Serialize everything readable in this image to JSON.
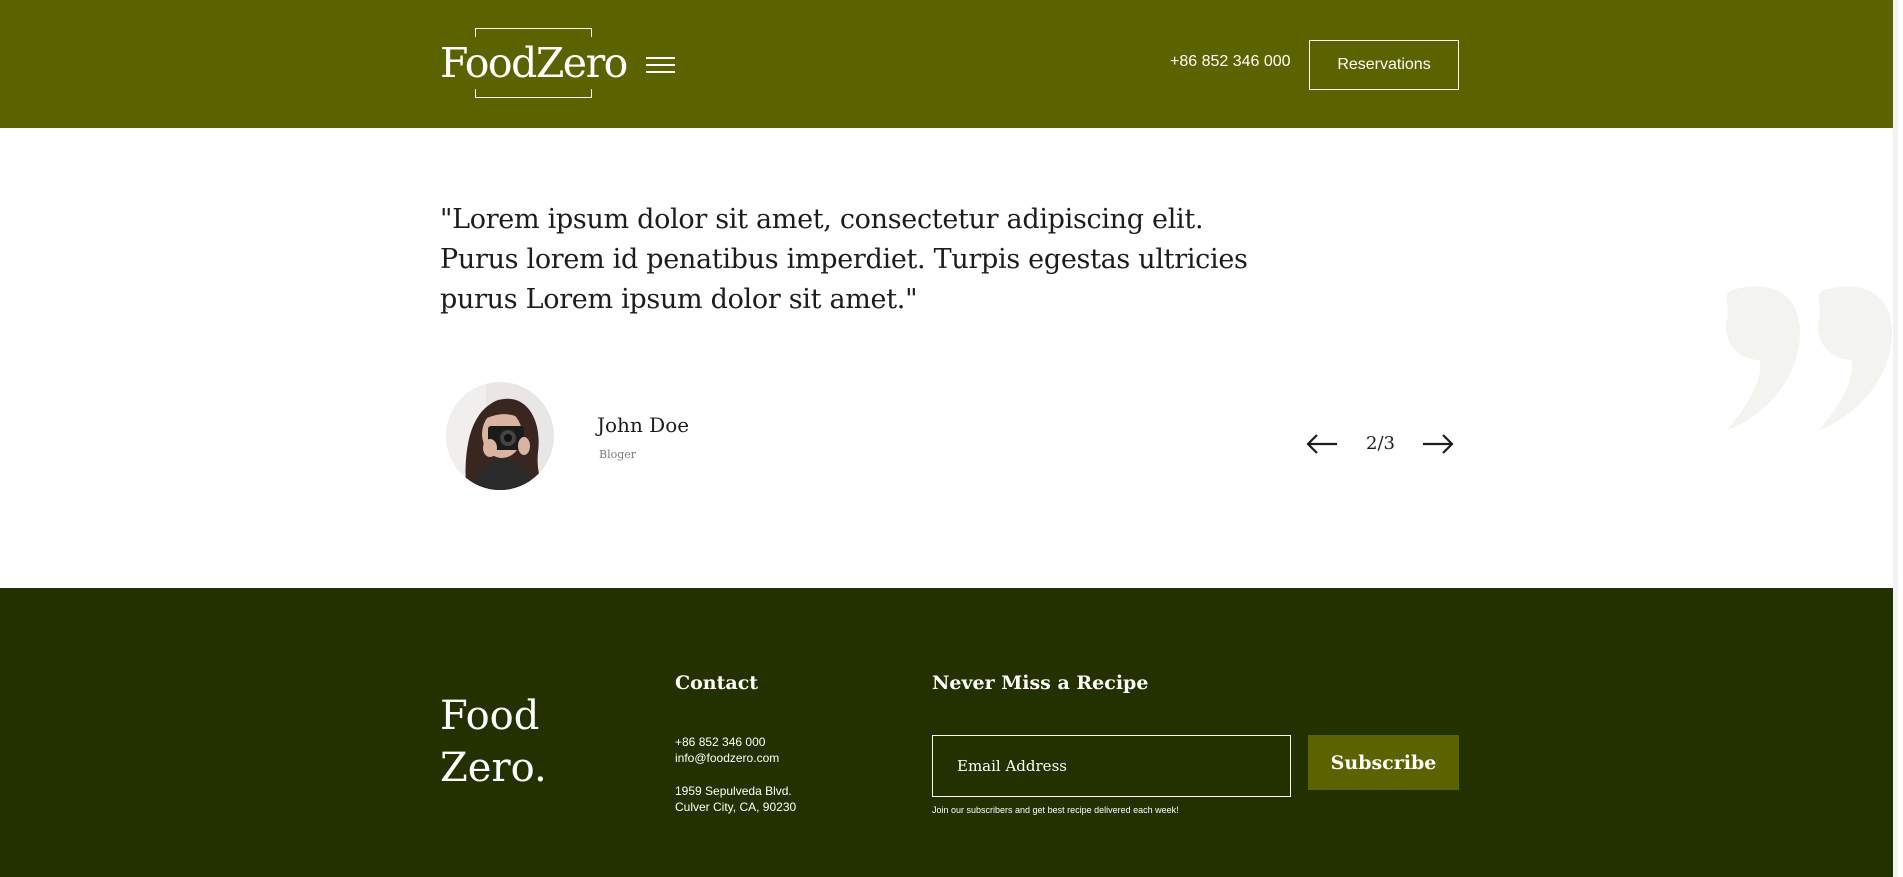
{
  "header": {
    "logo": "FoodZero",
    "phone": "+86 852 346 000",
    "reservations_label": "Reservations",
    "background_color": "#5a6300"
  },
  "testimonial": {
    "quote": "\"Lorem ipsum dolor sit amet, consectetur adipiscing elit. Purus lorem id penatibus imperdiet. Turpis egestas ultricies purus Lorem ipsum dolor sit amet.\"",
    "author_name": "John Doe",
    "author_role": "Bloger",
    "pager": "2/3",
    "prev_icon": "arrow-left-icon",
    "next_icon": "arrow-right-icon"
  },
  "footer": {
    "logo_line1": "Food",
    "logo_line2": "Zero.",
    "contact": {
      "heading": "Contact",
      "phone": "+86 852 346 000",
      "email": "info@foodzero.com",
      "address_line1": "1959 Sepulveda Blvd.",
      "address_line2": "Culver City, CA, 90230"
    },
    "newsletter": {
      "heading": "Never Miss a Recipe",
      "email_placeholder": "Email Address",
      "subscribe_label": "Subscribe",
      "note": "Join our subscribers and get best recipe delivered each week!"
    },
    "background_color": "#233000"
  }
}
